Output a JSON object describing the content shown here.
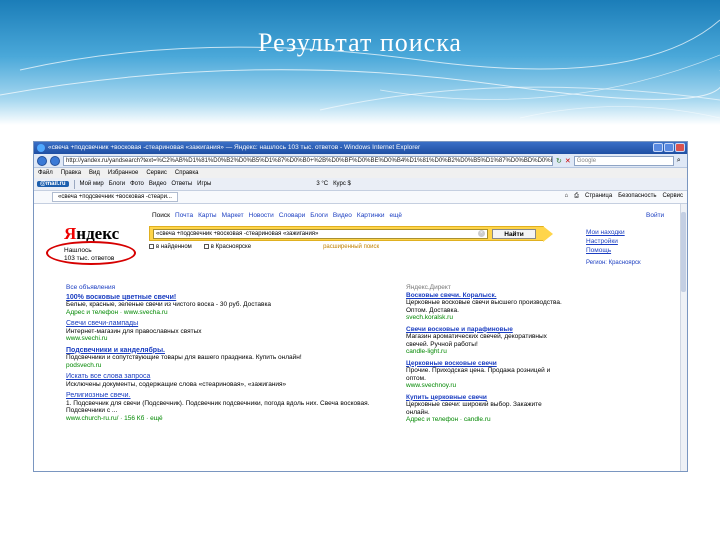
{
  "slide": {
    "title": "Результат поиска"
  },
  "window": {
    "title": "«свеча +подсвечник +восковая -стеариновая «зажигания» — Яндекс: нашлось 103 тыс. ответов - Windows Internet Explorer"
  },
  "browser": {
    "address": "http://yandex.ru/yandsearch?text=%C2%AB%D1%81%D0%B2%D0%B5%D1%87%D0%B0+%2B%D0%BF%D0%BE%D0%B4%D1%81%D0%B2%D0%B5%D1%87%D0%BD%D0%B8%D0%BA",
    "search_placeholder": "Google",
    "menu": [
      "Файл",
      "Правка",
      "Вид",
      "Избранное",
      "Сервис",
      "Справка"
    ],
    "toolbar": {
      "mail": "@mail.ru",
      "items": [
        "Мой мир",
        "Блоги",
        "Фото",
        "Видео",
        "Ответы",
        "Игры",
        "3 °C",
        "Курс $"
      ]
    },
    "tab_label": "«свеча +подсвечник +восковая -стеари...",
    "tab_tools": [
      "Страница",
      "Безопасность",
      "Сервис"
    ]
  },
  "yandex": {
    "logo_first": "Я",
    "logo_rest": "ндекс",
    "found_line1": "Нашлось",
    "found_line2": "103 тыс. ответов",
    "nav": [
      {
        "label": "Поиск",
        "link": false
      },
      {
        "label": "Почта",
        "link": true
      },
      {
        "label": "Карты",
        "link": true
      },
      {
        "label": "Маркет",
        "link": true
      },
      {
        "label": "Новости",
        "link": true
      },
      {
        "label": "Словари",
        "link": true
      },
      {
        "label": "Блоги",
        "link": true
      },
      {
        "label": "Видео",
        "link": true
      },
      {
        "label": "Картинки",
        "link": true
      },
      {
        "label": "ещё",
        "link": true
      }
    ],
    "query": "«свеча +подсвечник +восковая -стеариновая «зажигания»",
    "find_button": "Найти",
    "options": [
      "в найденном",
      "в Красноярске"
    ],
    "hint": "расширенный поиск",
    "right_links": [
      "Мои находки",
      "Настройки",
      "Помощь"
    ],
    "region": "Регион: Красноярск",
    "enter": "Войти"
  },
  "results": {
    "heading": "Все объявления",
    "items": [
      {
        "title": "100% восковые цветные свечи!",
        "snippet": "Белые, красные, зеленые свечи из чистого воска - 30 руб. Доставка",
        "url": "Адрес и телефон · www.svecha.ru",
        "big": true
      },
      {
        "title": "Свечи свечи-лампады",
        "snippet": "Интернет-магазин для православных святых",
        "url": "www.svechi.ru",
        "big": false
      },
      {
        "title": "Подсвечники и канделябры.",
        "snippet": "Подсвечники и сопутствующие товары для вашего праздника. Купить онлайн!",
        "url": "podsvech.ru",
        "big": true
      },
      {
        "title": "Искать все слова запроса",
        "snippet": "Исключены документы, содержащие слова «стеариновая», «зажигания»",
        "url": "",
        "big": false
      },
      {
        "title": "Религиозные свечи.",
        "snippet": "1. Подсвечник для свечи (Подсвечник). Подсвечник подсвечники, погода вдоль них. Свеча восковая. Подсвечники с ...",
        "url": "www.church-ru.ru/ · 156 Кб · ещё",
        "big": false
      }
    ]
  },
  "ads": {
    "heading": "Яндекс.Директ",
    "items": [
      {
        "title": "Восковые свечи. Коралыск.",
        "snippet": "Церковные восковые свечи высшего производства. Оптом. Доставка.",
        "url": "svech.koralsk.ru"
      },
      {
        "title": "Свечи восковые и парафиновые",
        "snippet": "Магазин ароматических свечей, декоративных свечей. Ручной работы!",
        "url": "candle-light.ru"
      },
      {
        "title": "Церковные восковые свечи",
        "snippet": "Прочие. Приходская цена. Продажа розницей и оптом.",
        "url": "www.svechnoy.ru"
      },
      {
        "title": "Купить церковные свечи",
        "snippet": "Церковные свечи: широкий выбор. Закажите онлайн.",
        "url": "Адрес и телефон · candle.ru"
      }
    ]
  }
}
